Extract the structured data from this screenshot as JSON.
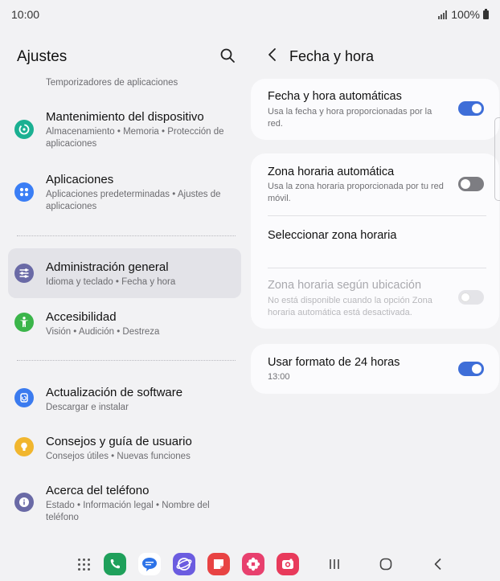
{
  "status": {
    "time": "10:00",
    "battery": "100%"
  },
  "left": {
    "title": "Ajustes",
    "top_subtitle": "Temporizadores de aplicaciones",
    "items": [
      {
        "title": "Mantenimiento del dispositivo",
        "subtitle": "Almacenamiento  •  Memoria  •  Protección de aplicaciones",
        "icon": "device-care-icon",
        "color": "#1bb092"
      },
      {
        "title": "Aplicaciones",
        "subtitle": "Aplicaciones predeterminadas  •  Ajustes de aplicaciones",
        "icon": "apps-icon",
        "color": "#3a7ef5"
      },
      {
        "title": "Administración general",
        "subtitle": "Idioma y teclado  •  Fecha y hora",
        "icon": "sliders-icon",
        "color": "#6a6aa6"
      },
      {
        "title": "Accesibilidad",
        "subtitle": "Visión  •  Audición  •  Destreza",
        "icon": "accessibility-icon",
        "color": "#3bb54a"
      },
      {
        "title": "Actualización de software",
        "subtitle": "Descargar e instalar",
        "icon": "software-update-icon",
        "color": "#3b7bef"
      },
      {
        "title": "Consejos y guía de usuario",
        "subtitle": "Consejos útiles  •  Nuevas funciones",
        "icon": "lightbulb-icon",
        "color": "#f1b62e"
      },
      {
        "title": "Acerca del teléfono",
        "subtitle": "Estado  •  Información legal  •  Nombre del teléfono",
        "icon": "info-icon",
        "color": "#6a6aa6"
      }
    ]
  },
  "right": {
    "title": "Fecha y hora",
    "auto_datetime": {
      "title": "Fecha y hora automáticas",
      "subtitle": "Usa la fecha y hora proporcionadas por la red.",
      "state": "on"
    },
    "auto_timezone": {
      "title": "Zona horaria automática",
      "subtitle": "Usa la zona horaria proporcionada por tu red móvil.",
      "state": "off"
    },
    "select_timezone": {
      "title": "Seleccionar zona horaria"
    },
    "location_timezone": {
      "title": "Zona horaria según ubicación",
      "subtitle": "No está disponible cuando la opción Zona horaria automática está desactivada.",
      "state": "disabled"
    },
    "format24": {
      "title": "Usar formato de 24 horas",
      "subtitle": "13:00",
      "state": "on"
    }
  },
  "colors": {
    "accent": "#3e6ed8",
    "selected_bg": "#e3e3e8"
  },
  "dock": [
    {
      "name": "phone-app-icon",
      "color": "#1fa05b"
    },
    {
      "name": "messages-app-icon",
      "color": "#ffffff"
    },
    {
      "name": "internet-app-icon",
      "color": "#6b5ce0"
    },
    {
      "name": "notes-app-icon",
      "color": "#e84343"
    },
    {
      "name": "gallery-app-icon",
      "color": "#e8406e"
    },
    {
      "name": "camera-app-icon",
      "color": "#e83a5b"
    }
  ]
}
